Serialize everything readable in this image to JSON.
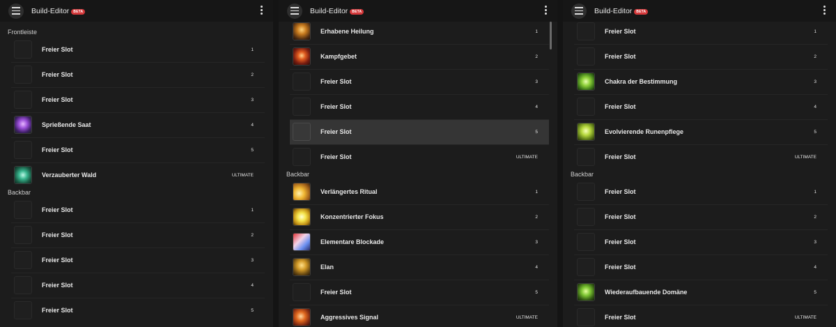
{
  "app": {
    "title": "Build-Editor",
    "badge": "BETA"
  },
  "panels": [
    {
      "offset": 0,
      "sections": [
        {
          "label": "Frontleiste",
          "slots": [
            {
              "name": "Freier Slot",
              "num": "1",
              "icon": ""
            },
            {
              "name": "Freier Slot",
              "num": "2",
              "icon": ""
            },
            {
              "name": "Freier Slot",
              "num": "3",
              "icon": ""
            },
            {
              "name": "Sprießende Saat",
              "num": "4",
              "icon": "radial-gradient(circle at 50% 45%, #e7b8ff 0%, #9b4fd8 35%, #3e1f66 70%, #1b2a1a 100%)"
            },
            {
              "name": "Freier Slot",
              "num": "5",
              "icon": ""
            },
            {
              "name": "Verzauberter Wald",
              "num": "ULTIMATE",
              "icon": "radial-gradient(circle at 50% 50%, #bdf7e6 0%, #38b58e 35%, #1b5b45 70%, #0d2a20 100%)"
            }
          ]
        },
        {
          "label": "Backbar",
          "slots": [
            {
              "name": "Freier Slot",
              "num": "1",
              "icon": ""
            },
            {
              "name": "Freier Slot",
              "num": "2",
              "icon": ""
            },
            {
              "name": "Freier Slot",
              "num": "3",
              "icon": ""
            },
            {
              "name": "Freier Slot",
              "num": "4",
              "icon": ""
            },
            {
              "name": "Freier Slot",
              "num": "5",
              "icon": ""
            }
          ]
        }
      ]
    },
    {
      "offset": -14,
      "sections": [
        {
          "label": "",
          "slots": [
            {
              "name": "Erhabene Heilung",
              "num": "1",
              "icon": "radial-gradient(circle at 50% 40%, #ffd27a 0%, #c77a1e 35%, #4c2a10 75%, #1c120a 100%)"
            },
            {
              "name": "Kampfgebet",
              "num": "2",
              "icon": "radial-gradient(circle at 50% 45%, #ffcf8a 0%, #e05b1f 30%, #7a1d10 65%, #2a0c07 100%)"
            },
            {
              "name": "Freier Slot",
              "num": "3",
              "icon": ""
            },
            {
              "name": "Freier Slot",
              "num": "4",
              "icon": ""
            },
            {
              "name": "Freier Slot",
              "num": "5",
              "icon": "",
              "highlight": true
            },
            {
              "name": "Freier Slot",
              "num": "ULTIMATE",
              "icon": ""
            }
          ]
        },
        {
          "label": "Backbar",
          "slots": [
            {
              "name": "Verlängertes Ritual",
              "num": "1",
              "icon": "radial-gradient(circle at 35% 60%, #fff2b0 0%, #f0b733 35%, #a2611a 70%, #3a210b 100%)"
            },
            {
              "name": "Konzentrierter Fokus",
              "num": "2",
              "icon": "radial-gradient(circle at 50% 50%, #ffffcf 0%, #f5e34a 35%, #c08e15 70%, #4a3306 100%)"
            },
            {
              "name": "Elementare Blockade",
              "num": "3",
              "icon": "linear-gradient(135deg, #e3383b 0%, #f2d3e7 40%, #6a8ff0 70%, #2a2e6e 100%)"
            },
            {
              "name": "Elan",
              "num": "4",
              "icon": "radial-gradient(circle at 50% 40%, #ffe08a 0%, #d29a28 35%, #6a4a12 70%, #231708 100%)"
            },
            {
              "name": "Freier Slot",
              "num": "5",
              "icon": ""
            },
            {
              "name": "Aggressives Signal",
              "num": "ULTIMATE",
              "icon": "radial-gradient(circle at 45% 45%, #ffd8a0 0%, #e0681e 35%, #802a12 70%, #2e0e07 100%)"
            }
          ]
        }
      ]
    },
    {
      "offset": -14,
      "sections": [
        {
          "label": "",
          "slots": [
            {
              "name": "Freier Slot",
              "num": "1",
              "icon": ""
            },
            {
              "name": "Freier Slot",
              "num": "2",
              "icon": ""
            },
            {
              "name": "Chakra der Bestimmung",
              "num": "3",
              "icon": "radial-gradient(circle at 50% 50%, #e8ffb0 0%, #8ed13a 35%, #3f7a1a 70%, #13290a 100%)"
            },
            {
              "name": "Freier Slot",
              "num": "4",
              "icon": ""
            },
            {
              "name": "Evolvierende Runenpflege",
              "num": "5",
              "icon": "radial-gradient(circle at 50% 45%, #f7ffb8 0%, #b6d83e 35%, #5d7a18 70%, #1e2908 100%)"
            },
            {
              "name": "Freier Slot",
              "num": "ULTIMATE",
              "icon": ""
            }
          ]
        },
        {
          "label": "Backbar",
          "slots": [
            {
              "name": "Freier Slot",
              "num": "1",
              "icon": ""
            },
            {
              "name": "Freier Slot",
              "num": "2",
              "icon": ""
            },
            {
              "name": "Freier Slot",
              "num": "3",
              "icon": ""
            },
            {
              "name": "Freier Slot",
              "num": "4",
              "icon": ""
            },
            {
              "name": "Wiederaufbauende Domäne",
              "num": "5",
              "icon": "radial-gradient(circle at 50% 45%, #e4ff9c 0%, #7cc532 35%, #355d14 70%, #0f1f06 100%)"
            },
            {
              "name": "Freier Slot",
              "num": "ULTIMATE",
              "icon": ""
            }
          ]
        }
      ]
    }
  ]
}
